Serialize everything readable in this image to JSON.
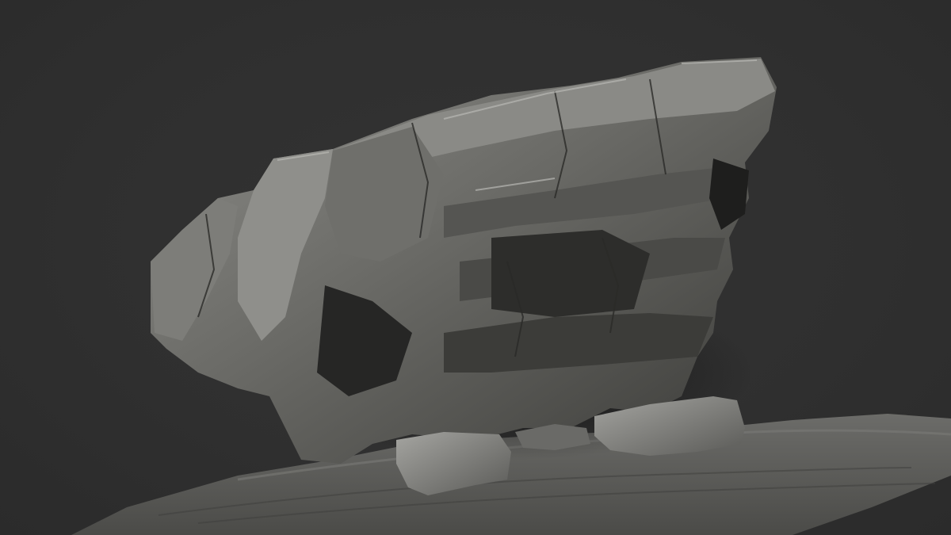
{
  "scene": {
    "subject": "rock-sculpt",
    "render_style": "matcap-grey",
    "colors": {
      "background": "#2f2f2f",
      "rock_light": "#9a9a96",
      "rock_mid": "#6b6b67",
      "rock_dark": "#3e3e3b",
      "rock_shadow": "#1a1a19",
      "ground": "#5f5f5c"
    }
  }
}
